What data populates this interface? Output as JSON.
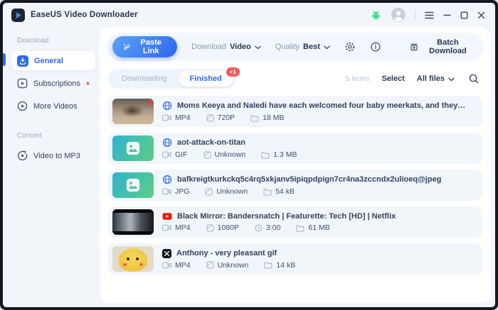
{
  "colors": {
    "accent_blue": "#2e6bf0",
    "badge_red": "#f25a5a",
    "android_green": "#3ddc84",
    "youtube_red": "#f61c0d",
    "media_thumb_gradient": [
      "#2fb3cf",
      "#5ecd85"
    ]
  },
  "titlebar": {
    "app_title": "EaseUS Video Downloader"
  },
  "sidebar": {
    "sections": [
      {
        "label": "Download",
        "items": [
          {
            "label": "General"
          },
          {
            "label": "Subscriptions"
          },
          {
            "label": "More Videos"
          }
        ]
      },
      {
        "label": "Convert",
        "items": [
          {
            "label": "Video to MP3"
          }
        ]
      }
    ]
  },
  "toolbar": {
    "paste_link_label": "Paste Link",
    "download_label": "Download",
    "download_value": "Video",
    "quality_label": "Quality",
    "quality_value": "Best",
    "batch_download_label": "Batch Download"
  },
  "tabs": {
    "downloading_label": "Downloading",
    "finished_label": "Finished",
    "finished_badge": "+1"
  },
  "list_controls": {
    "items_count": "5 items",
    "select_label": "Select",
    "filter_label": "All files"
  },
  "items": [
    {
      "source": "web",
      "title": "Moms Keeya and Naledi have each welcomed four baby meerkats, and they…",
      "format": "MP4",
      "resolution": "720P",
      "size": "18 MB"
    },
    {
      "source": "web",
      "title": "aot-attack-on-titan",
      "format": "GIF",
      "resolution": "Unknown",
      "size": "1.3 MB"
    },
    {
      "source": "web",
      "title": "bafkreigtkurkckq5c4rq5xkjanv5ipiqpdpign7cr4na3zccndx2ulioeq@jpeg",
      "format": "JPG",
      "resolution": "Unknown",
      "size": "54 kB"
    },
    {
      "source": "youtube",
      "title": "Black Mirror: Bandersnatch | Featurette: Tech [HD] | Netflix",
      "format": "MP4",
      "resolution": "1080P",
      "duration": "3:00",
      "size": "61 MB"
    },
    {
      "source": "x",
      "title": "Anthony - very pleasant gif",
      "format": "MP4",
      "resolution": "Unknown",
      "size": "14 kB"
    }
  ]
}
